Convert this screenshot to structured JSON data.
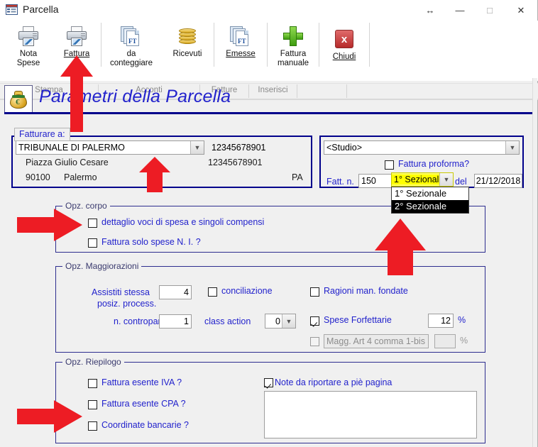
{
  "window": {
    "title": "Parcella",
    "icon": "window-list-icon",
    "controls": [
      {
        "name": "resize-button",
        "glyph": "↔"
      },
      {
        "name": "minimize-button",
        "glyph": "—"
      },
      {
        "name": "maximize-button",
        "glyph": "□"
      },
      {
        "name": "close-button",
        "glyph": "✕"
      }
    ]
  },
  "ribbon": {
    "buttons": [
      {
        "name": "nota-spese",
        "icon": "printer-icon",
        "line1": "Nota",
        "line2": "Spese",
        "accel": "N"
      },
      {
        "name": "fattura",
        "icon": "printer-icon",
        "line1": "Fattura",
        "line2": "",
        "accel": "F"
      },
      {
        "name": "da-conteggiare",
        "icon": "documents-ft-icon",
        "line1": "da",
        "line2": "conteggiare",
        "accel": ""
      },
      {
        "name": "ricevuti",
        "icon": "coins-icon",
        "line1": "Ricevuti",
        "line2": "",
        "accel": ""
      },
      {
        "name": "emesse",
        "icon": "documents-ft-icon",
        "line1": "Emesse",
        "line2": "",
        "accel": "E"
      },
      {
        "name": "fattura-manuale",
        "icon": "plus-icon",
        "line1": "Fattura",
        "line2": "manuale",
        "accel": ""
      },
      {
        "name": "chiudi",
        "icon": "close-x-icon",
        "line1": "Chiudi",
        "line2": "",
        "accel": "C"
      }
    ],
    "groups": [
      {
        "name": "stampa",
        "label": "Stampa"
      },
      {
        "name": "acconti",
        "label": "Acconti"
      },
      {
        "name": "fatture",
        "label": "Fatture"
      },
      {
        "name": "inserisci",
        "label": "Inserisci"
      }
    ]
  },
  "page": {
    "title": "Parametri della Parcella",
    "icon": "money-bag-icon"
  },
  "fatturare_a": {
    "caption": "Fatturare a:",
    "recipient_value": "TRIBUNALE DI PALERMO",
    "address": "Piazza Giulio Cesare",
    "cap": "90100",
    "city": "Palermo",
    "province": "PA",
    "code1": "12345678901",
    "code2": "12345678901"
  },
  "studio": {
    "selected": "<Studio>",
    "proforma_label": "Fattura proforma?",
    "proforma_checked": false,
    "fatt_n_label": "Fatt. n.",
    "fatt_n_value": "150",
    "sezionale_value": "1° Sezionale",
    "sezionale_options": [
      "1° Sezionale",
      "2° Sezionale"
    ],
    "sezionale_highlighted": "2° Sezionale",
    "del_label": "del",
    "date_value": "21/12/2018"
  },
  "opz_corpo": {
    "caption": "Opz. corpo",
    "items": [
      {
        "name": "dettaglio-voci",
        "label": "dettaglio voci di spesa e singoli compensi",
        "checked": false
      },
      {
        "name": "fattura-solo-spese",
        "label": "Fattura solo spese N. I. ?",
        "checked": false
      }
    ]
  },
  "opz_maggiorazioni": {
    "caption": "Opz. Maggiorazioni",
    "assistiti_label_l1": "Assistiti stessa",
    "assistiti_label_l2": "posiz. process.",
    "assistiti_value": "4",
    "controparti_label": "n. controparti",
    "controparti_value": "1",
    "conciliazione_label": "conciliazione",
    "conciliazione_checked": false,
    "class_action_label": "class action",
    "class_action_value": "0",
    "ragioni_label": "Ragioni man. fondate",
    "ragioni_checked": false,
    "spese_forfettarie_label": "Spese Forfettarie",
    "spese_forfettarie_checked": true,
    "spese_forfettarie_value": "12",
    "percent_symbol": "%",
    "magg_art4_label": "Magg. Art 4 comma 1-bis",
    "magg_art4_checked": false,
    "magg_art4_value": "",
    "percent_symbol2": "%"
  },
  "opz_riepilogo": {
    "caption": "Opz. Riepilogo",
    "items": [
      {
        "name": "fattura-esente-iva",
        "label": "Fattura esente IVA ?",
        "checked": false
      },
      {
        "name": "fattura-esente-cpa",
        "label": "Fattura esente CPA ?",
        "checked": false
      },
      {
        "name": "coordinate-bancarie",
        "label": "Coordinate bancarie ?",
        "checked": false
      }
    ],
    "note_label": "Note da riportare a piè pagina",
    "note_checked": true,
    "note_value": ""
  },
  "annotations": {
    "arrow_color": "#ed1c24",
    "arrows": [
      {
        "name": "arrow-to-fattura-button",
        "direction": "up"
      },
      {
        "name": "arrow-to-recipient-combo",
        "direction": "up"
      },
      {
        "name": "arrow-to-dettaglio-checkbox",
        "direction": "right"
      },
      {
        "name": "arrow-to-sezionale-dropdown",
        "direction": "up"
      },
      {
        "name": "arrow-to-coordinate-bancarie-checkbox",
        "direction": "right"
      }
    ]
  }
}
